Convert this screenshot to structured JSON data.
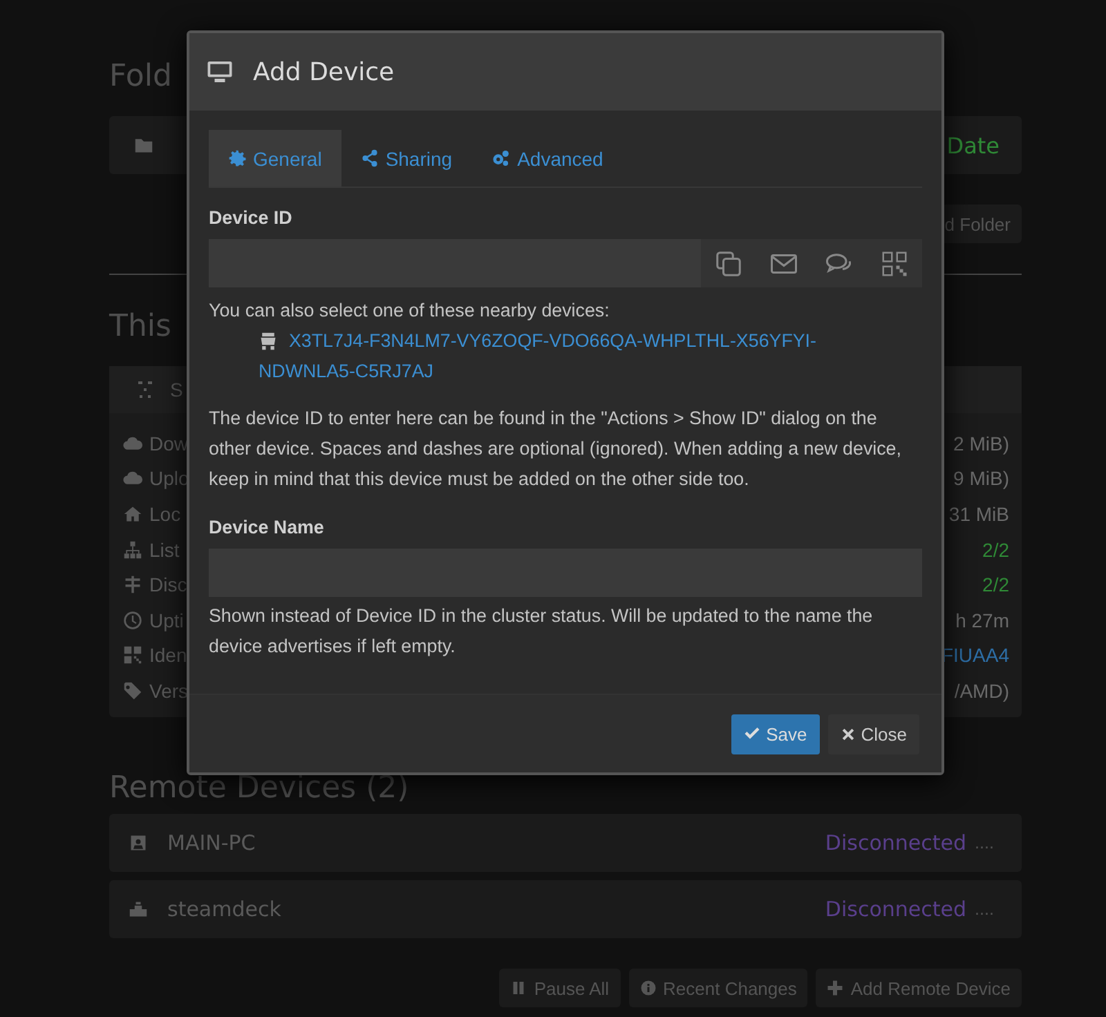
{
  "background": {
    "folders_heading": "Fold",
    "folder_status": "Date",
    "add_folder_button": "d Folder",
    "this_device_heading": "This",
    "this_device_name": "S",
    "stats": [
      {
        "label": "Dow",
        "value": "2 MiB)",
        "color": "#6a6a6a"
      },
      {
        "label": "Uplo",
        "value": "9 MiB)",
        "color": "#6a6a6a"
      },
      {
        "label": "Loc",
        "value": "31 MiB",
        "color": "#6a6a6a"
      },
      {
        "label": "List",
        "value": "2/2",
        "color": "#2f8a36"
      },
      {
        "label": "Disc",
        "value": "2/2",
        "color": "#2f8a36"
      },
      {
        "label": "Upti",
        "value": "h 27m",
        "color": "#6a6a6a"
      },
      {
        "label": "Iden",
        "value": "FIUAA4",
        "color": "#2d6ea6"
      },
      {
        "label": "Vers",
        "value": "/AMD)",
        "color": "#6a6a6a"
      }
    ],
    "remote_heading": "Remote Devices (2)",
    "remote_devices": [
      {
        "name": "MAIN-PC",
        "status": "Disconnected",
        "extra": "...."
      },
      {
        "name": "steamdeck",
        "status": "Disconnected",
        "extra": "...."
      }
    ],
    "buttons": [
      "Pause All",
      "Recent Changes",
      "Add Remote Device"
    ]
  },
  "dialog": {
    "title": "Add Device",
    "tabs": [
      {
        "label": "General",
        "selected": true
      },
      {
        "label": "Sharing",
        "selected": false
      },
      {
        "label": "Advanced",
        "selected": false
      }
    ],
    "device_id_label": "Device ID",
    "nearby_intro": "You can also select one of these nearby devices:",
    "nearby_devices": [
      "X3TL7J4-F3N4LM7-VY6ZOQF-VDO66QA-WHPLTHL-X56YFYI-NDWNLA5-C5RJ7AJ"
    ],
    "device_id_help": "The device ID to enter here can be found in the \"Actions > Show ID\" dialog on the other device. Spaces and dashes are optional (ignored). When adding a new device, keep in mind that this device must be added on the other side too.",
    "device_name_label": "Device Name",
    "device_name_help": "Shown instead of Device ID in the cluster status. Will be updated to the name the device advertises if left empty.",
    "buttons": [
      {
        "label": "Save",
        "kind": "primary"
      },
      {
        "label": "Close",
        "kind": "default"
      }
    ]
  }
}
